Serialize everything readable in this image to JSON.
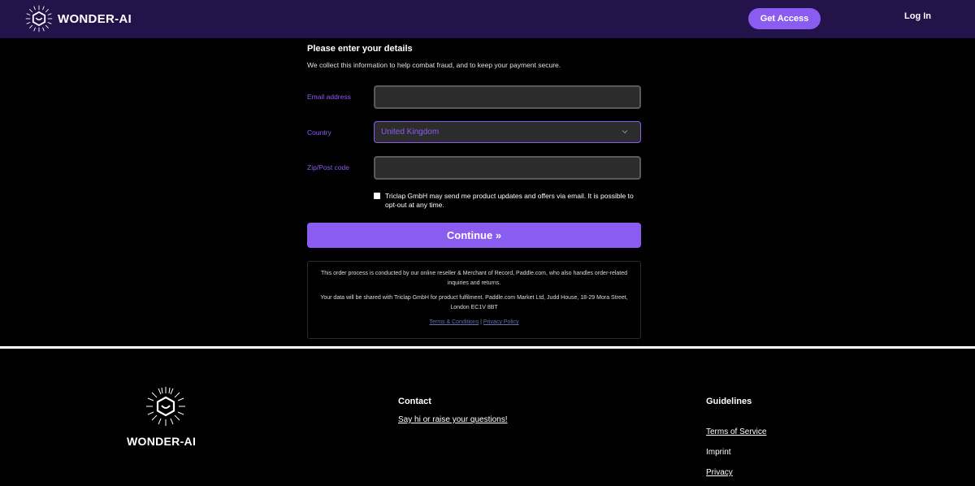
{
  "header": {
    "brand": "WONDER-AI",
    "get_access_label": "Get Access",
    "login_label": "Log In"
  },
  "form": {
    "title": "Please enter your details",
    "subtitle": "We collect this information to help combat fraud, and to keep your payment secure.",
    "email_label": "Email address",
    "email_value": "",
    "country_label": "Country",
    "country_value": "United Kingdom",
    "zip_label": "Zip/Post code",
    "zip_value": "",
    "consent_text": "Triclap GmbH may send me product updates and offers via email. It is possible to opt-out at any time.",
    "consent_checked": false,
    "continue_label": "Continue »"
  },
  "notice": {
    "paragraph1": "This order process is conducted by our online reseller & Merchant of Record, Paddle.com, who also handles order-related inquiries and returns.",
    "paragraph2": "Your data will be shared with Triclap GmbH for product fulfilment. Paddle.com Market Ltd, Judd House, 18-29 Mora Street, London EC1V 8BT",
    "terms_label": "Terms & Conditions",
    "separator": " | ",
    "privacy_label": "Privacy Policy"
  },
  "footer": {
    "brand": "WONDER-AI",
    "contact_heading": "Contact",
    "contact_link": "Say hi or raise your questions!",
    "guidelines_heading": "Guidelines",
    "terms_link": "Terms of Service",
    "imprint_link": "Imprint",
    "privacy_link": "Privacy"
  },
  "colors": {
    "header_bg": "#24124a",
    "accent": "#8a5cf0",
    "page_bg": "#000000"
  }
}
